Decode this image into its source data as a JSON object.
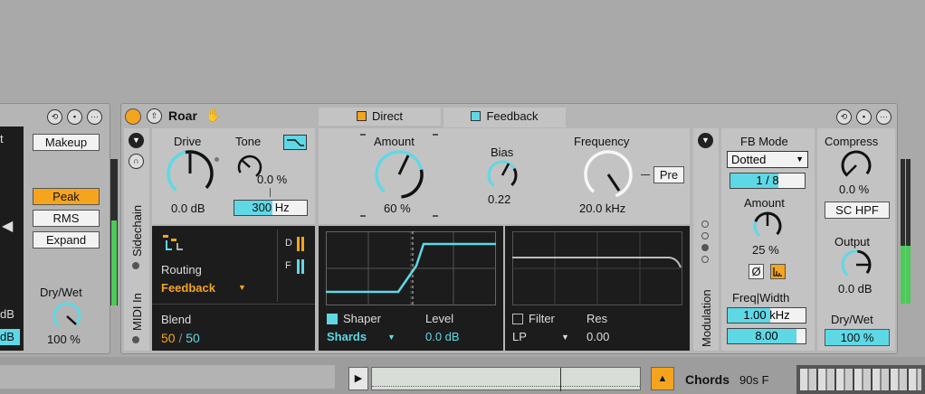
{
  "left_device": {
    "cut_label": "t",
    "makeup_label": "Makeup",
    "peak_label": "Peak",
    "rms_label": "RMS",
    "expand_label": "Expand",
    "drywet_label": "Dry/Wet",
    "drywet_value": "100 %",
    "db_label": "dB",
    "db_label2": "dB",
    "play_glyph": "◀"
  },
  "device": {
    "name": "Roar",
    "hand_glyph": "✋",
    "tabs": [
      {
        "label": "Direct",
        "color": "#f5a41e"
      },
      {
        "label": "Feedback",
        "color": "#5fd8e6"
      }
    ],
    "left_strip": {
      "sidechain_label": "Sidechain",
      "midi_label": "MIDI In"
    },
    "drive": {
      "label": "Drive",
      "value": "0.0 dB"
    },
    "tone": {
      "label": "Tone",
      "value": "0.0 %",
      "freq": "300 Hz"
    },
    "amount": {
      "label": "Amount",
      "value": "60 %"
    },
    "bias": {
      "label": "Bias",
      "value": "0.22"
    },
    "frequency": {
      "label": "Frequency",
      "value": "20.0 kHz",
      "pre_label": "Pre"
    },
    "routing": {
      "label": "Routing",
      "value": "Feedback",
      "d_label": "D",
      "f_label": "F"
    },
    "blend": {
      "label": "Blend",
      "a": "50",
      "sep": "/",
      "b": "50"
    },
    "shaper": {
      "label": "Shaper",
      "type": "Shards",
      "level_label": "Level",
      "level_value": "0.0 dB"
    },
    "filter": {
      "label": "Filter",
      "type": "LP",
      "res_label": "Res",
      "res_value": "0.00"
    },
    "modulation_label": "Modulation",
    "fb_mode": {
      "label": "FB Mode",
      "value": "Dotted",
      "division": "1 / 8",
      "amount_label": "Amount",
      "amount_value": "25 %",
      "phase_glyph": "Ø",
      "freq_width_label": "Freq|Width",
      "freq_value": "1.00 kHz",
      "width_value": "8.00"
    },
    "compress": {
      "label": "Compress",
      "value": "0.0 %",
      "sc_hpf_label": "SC HPF"
    },
    "output": {
      "label": "Output",
      "value": "0.0 dB"
    },
    "drywet": {
      "label": "Dry/Wet",
      "value": "100 %"
    }
  },
  "bottom_bar": {
    "play_glyph": "▶",
    "warning_glyph": "▲",
    "clip_name": "Chords",
    "clip_sub": "90s F"
  },
  "colors": {
    "accent_orange": "#f5a41e",
    "accent_cyan": "#5fd8e6",
    "meter_green": "#4dca5a"
  }
}
